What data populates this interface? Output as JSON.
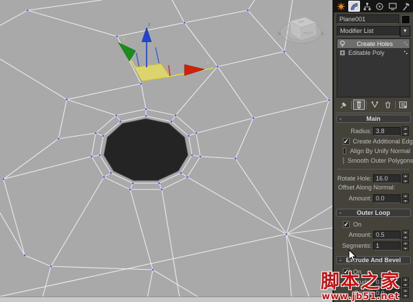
{
  "viewport": {
    "background": "#a9a9a9",
    "wire_color": "#ececec",
    "vertex_color": "#5b5bd0",
    "hole_color": "#242424",
    "viewcube": {
      "top": "TOP",
      "front": "FRONT"
    },
    "gizmo": {
      "x_label": "x",
      "y_label": "y",
      "z_label": "z",
      "x_color": "#cf2008",
      "y_color": "#1c8c1c",
      "z_color": "#2753e0",
      "plane_color": "#e8e060"
    }
  },
  "panel": {
    "tabs": [
      {
        "icon": "create-starburst-icon",
        "selected": false
      },
      {
        "icon": "modify-icon",
        "selected": true
      },
      {
        "icon": "hierarchy-icon",
        "selected": false
      },
      {
        "icon": "motion-icon",
        "selected": false
      },
      {
        "icon": "display-icon",
        "selected": false
      },
      {
        "icon": "utilities-hammer-icon",
        "selected": false
      }
    ],
    "object_name": "Plane001",
    "modifier_list_label": "Modifier List",
    "modifier_stack": [
      {
        "label": "Create Holes",
        "icon": "bulb-icon",
        "selected": true
      },
      {
        "label": "Editable Poly",
        "icon": "poly-object-icon",
        "selected": false
      }
    ],
    "stack_toolbar": [
      "pin-stack",
      "show-end-result",
      "make-unique",
      "remove-modifier",
      "configure-modifier-sets"
    ],
    "rollouts": {
      "main": {
        "collapse_glyph": "-",
        "title": "Main",
        "radius": {
          "label": "Radius:",
          "value": "3.8"
        },
        "checkboxes": [
          {
            "label": "Create Additional Edges",
            "checked": true
          },
          {
            "label": "Align By Unify Normal",
            "checked": false
          },
          {
            "label": "Smooth Outer Polygons",
            "checked": false
          }
        ],
        "rotate_hole": {
          "label": "Rotate Hole:",
          "value": "16.0"
        },
        "offset_heading": "Offset Along Normal:",
        "offset_amount": {
          "label": "Amount:",
          "value": "0.0"
        }
      },
      "outer_loop": {
        "collapse_glyph": "-",
        "title": "Outer Loop",
        "on": {
          "label": "On",
          "checked": true
        },
        "amount": {
          "label": "Amount:",
          "value": "0.5"
        },
        "segments": {
          "label": "Segments:",
          "value": "1"
        }
      },
      "extrude_bevel": {
        "collapse_glyph": "-",
        "title": "Extrude And Bevel",
        "on": {
          "label": "On",
          "checked": true
        },
        "extrude": {
          "label": "Extrude:",
          "value": "0.0"
        },
        "bevel": {
          "label": "Bevel:",
          "value": "0.0"
        }
      }
    }
  },
  "watermark": {
    "title": "脚本之家",
    "url": "www.jb51.net",
    "color": "#c41212"
  }
}
